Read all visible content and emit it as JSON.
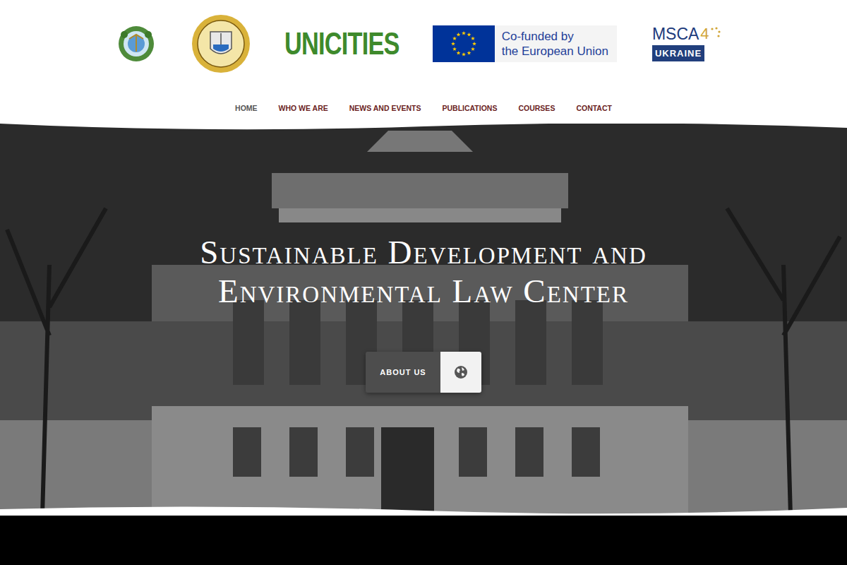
{
  "logos": {
    "brand": "UNICITIES",
    "eu_lines": [
      "Co-funded by",
      "the European Union"
    ],
    "msca": {
      "name": "MSCA",
      "number": "4",
      "country": "UKRAINE"
    }
  },
  "nav": [
    {
      "label": "HOME",
      "selected": true
    },
    {
      "label": "WHO WE ARE",
      "selected": false
    },
    {
      "label": "NEWS AND EVENTS",
      "selected": false
    },
    {
      "label": "PUBLICATIONS",
      "selected": false
    },
    {
      "label": "COURSES",
      "selected": false
    },
    {
      "label": "CONTACT",
      "selected": false
    }
  ],
  "hero": {
    "title_lines": [
      "Sustainable Development and",
      "Environmental Law Center"
    ],
    "button": "ABOUT US"
  }
}
